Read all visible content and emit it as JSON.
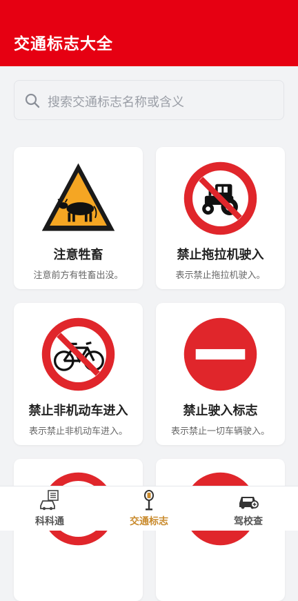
{
  "header": {
    "title": "交通标志大全"
  },
  "search": {
    "placeholder": "搜索交通标志名称或含义",
    "icon": "search-icon"
  },
  "signs": [
    {
      "name": "注意牲畜",
      "desc": "注意前方有牲畜出没。",
      "icon": "cattle-warning-sign"
    },
    {
      "name": "禁止拖拉机驶入",
      "desc": "表示禁止拖拉机驶入。",
      "icon": "no-tractor-sign"
    },
    {
      "name": "禁止非机动车进入",
      "desc": "表示禁止非机动车进入。",
      "icon": "no-bicycle-sign"
    },
    {
      "name": "禁止驶入标志",
      "desc": "表示禁止一切车辆驶入。",
      "icon": "no-entry-sign"
    }
  ],
  "tabbar": {
    "tabs": [
      {
        "label": "科科通",
        "icon": "car-list-icon"
      },
      {
        "label": "交通标志",
        "icon": "road-sign-icon"
      },
      {
        "label": "驾校查",
        "icon": "car-search-icon"
      }
    ],
    "active": "交通标志"
  },
  "colors": {
    "brand_red": "#e60012",
    "warning_orange": "#f5a623",
    "prohibition_red": "#e0262b",
    "active_tab": "#c98a2c"
  }
}
